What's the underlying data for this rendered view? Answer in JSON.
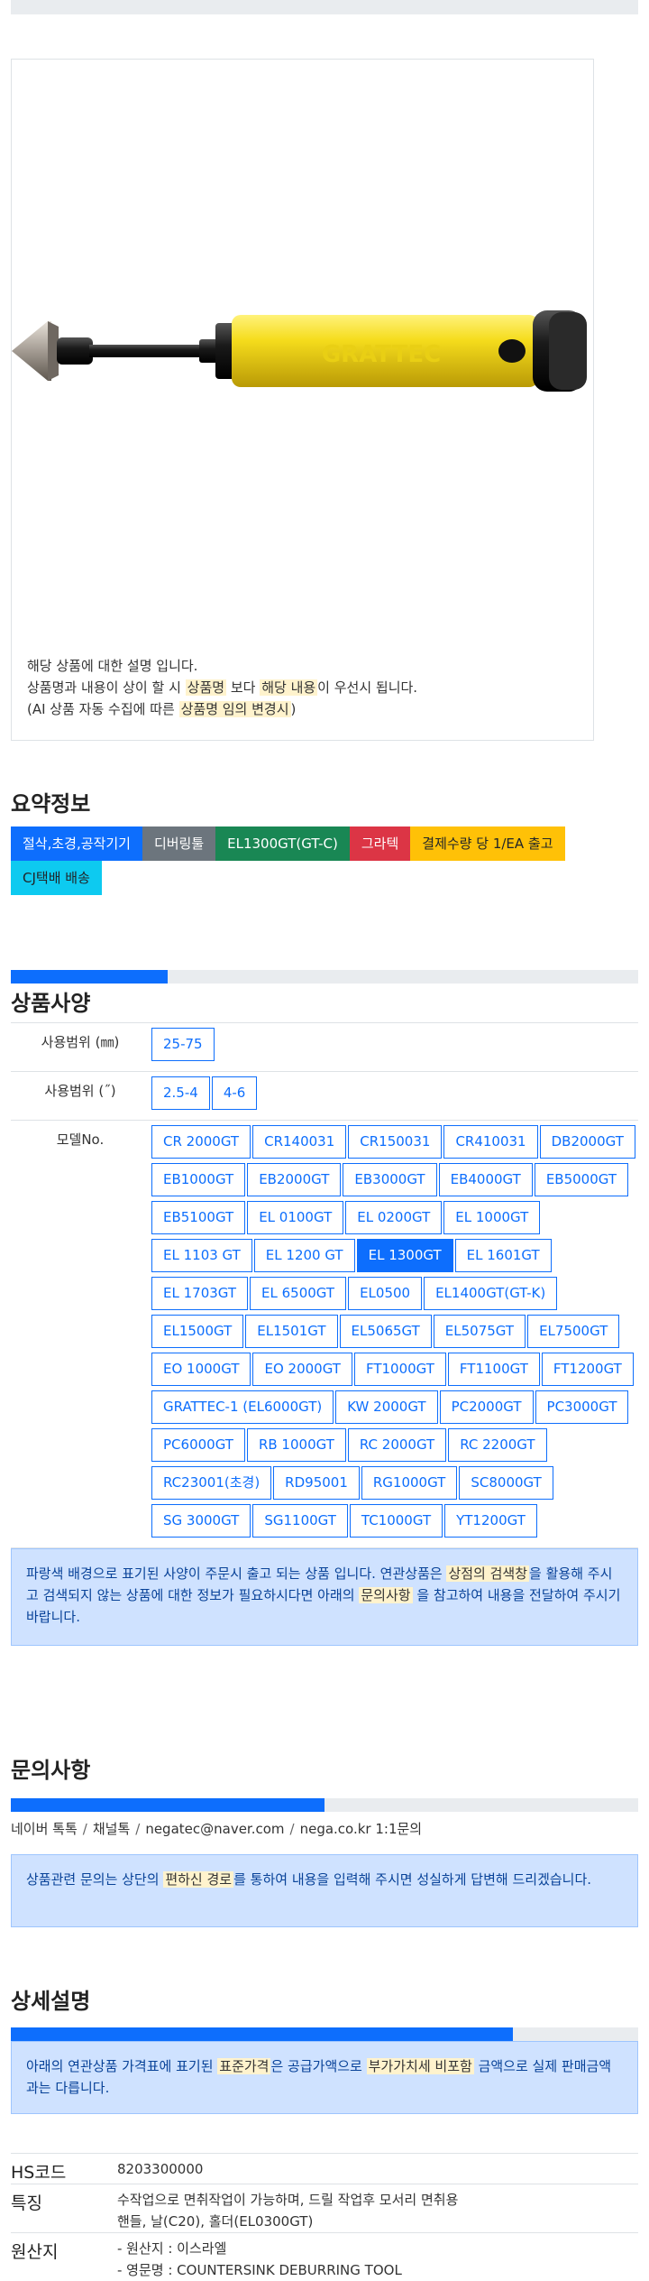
{
  "description": {
    "line1": "해당 상품에 대한 설명 입니다.",
    "line2_pre": "상품명과 내용이 상이 할 시 ",
    "line2_hl1": "상품명",
    "line2_mid": " 보다 ",
    "line2_hl2": "해당 내용",
    "line2_post": "이 우선시 됩니다.",
    "line3_pre": "(AI 상품 자동 수집에 따른 ",
    "line3_hl": "상품명 임의 변경시",
    "line3_post": ")"
  },
  "product_image": {
    "brand_text": "GRATTEC"
  },
  "summary": {
    "title": "요약정보",
    "badges": [
      "절삭,초경,공작기기",
      "디버링툴",
      "EL1300GT(GT-C)",
      "그라텍",
      "결제수량 당 1/EA 출고",
      "CJ택배 배송"
    ]
  },
  "spec": {
    "progress": 0.25,
    "title": "상품사양",
    "rows": [
      {
        "label": "사용범위 (㎜)",
        "options": [
          "25-75"
        ]
      },
      {
        "label": "사용범위 (˝)",
        "options": [
          "2.5-4",
          "4-6"
        ]
      },
      {
        "label": "모델No.",
        "options": [
          "CR 2000GT",
          "CR140031",
          "CR150031",
          "CR410031",
          "DB2000GT",
          "EB1000GT",
          "EB2000GT",
          "EB3000GT",
          "EB4000GT",
          "EB5000GT",
          "EB5100GT",
          "EL 0100GT",
          "EL 0200GT",
          "EL 1000GT",
          "EL 1103 GT",
          "EL 1200 GT",
          "EL 1300GT",
          "EL 1601GT",
          "EL 1703GT",
          "EL 6500GT",
          "EL0500",
          "EL1400GT(GT-K)",
          "EL1500GT",
          "EL1501GT",
          "EL5065GT",
          "EL5075GT",
          "EL7500GT",
          "EO 1000GT",
          "EO 2000GT",
          "FT1000GT",
          "FT1100GT",
          "FT1200GT",
          "GRATTEC-1 (EL6000GT)",
          "KW 2000GT",
          "PC2000GT",
          "PC3000GT",
          "PC6000GT",
          "RB 1000GT",
          "RC 2000GT",
          "RC 2200GT",
          "RC23001(초경)",
          "RD95001",
          "RG1000GT",
          "SC8000GT",
          "SG 3000GT",
          "SG1100GT",
          "TC1000GT",
          "YT1200GT"
        ],
        "selected": "EL 1300GT"
      }
    ],
    "notice_pre": "파랑색 배경으로 표기된 사양이 주문시 출고 되는 상품 입니다. 연관상품은 ",
    "notice_hl1": "상점의 검색창",
    "notice_mid": "을 활용해 주시고 검색되지 않는 상품에 대한 정보가 필요하시다면 아래의 ",
    "notice_hl2": "문의사항",
    "notice_post": " 을 참고하여 내용을 전달하여 주시기 바랍니다."
  },
  "inquiry": {
    "progress": 0.5,
    "title": "문의사항",
    "links": [
      "네이버 톡톡",
      "채널톡",
      "negatec@naver.com",
      "nega.co.kr 1:1문의"
    ],
    "notice_pre": "상품관련 문의는 상단의 ",
    "notice_hl": "편하신 경로",
    "notice_post": "를 통하여 내용을 입력해 주시면 성실하게 답변해 드리겠습니다."
  },
  "detail": {
    "progress": 0.8,
    "title": "상세설명",
    "notice_pre": "아래의 연관상품 가격표에 표기된 ",
    "notice_hl1": "표준가격",
    "notice_mid": "은 공급가액으로 ",
    "notice_hl2": "부가가치세 비포함",
    "notice_post": " 금액으로 실제 판매금액과는 다릅니다.",
    "info": [
      {
        "key": "HS코드",
        "lines": [
          "8203300000"
        ]
      },
      {
        "key": "특징",
        "lines": [
          "수작업으로 면취작업이 가능하며, 드릴 작업후 모서리 면취용",
          "핸들, 날(C20), 홀더(EL0300GT)"
        ]
      },
      {
        "key": "원산지",
        "lines": [
          "- 원산지 : 이스라엘",
          "- 영문명 : COUNTERSINK DEBURRING TOOL"
        ]
      }
    ]
  },
  "colors": {
    "primary": "#0d6efd",
    "secondary": "#6c757d",
    "success": "#198754",
    "danger": "#dc3545",
    "warning": "#ffc107",
    "info": "#0dcaf0",
    "handle": "#f5dc1c"
  }
}
